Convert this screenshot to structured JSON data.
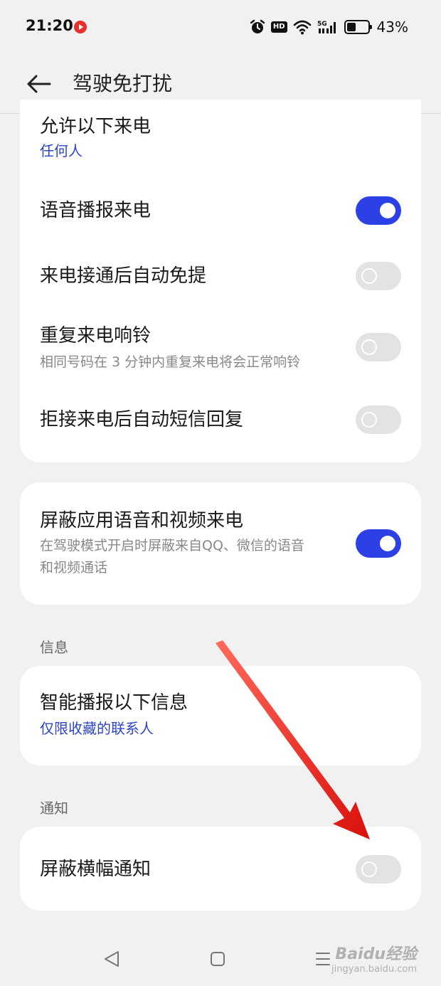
{
  "status_bar": {
    "time": "21:20",
    "indicators": [
      "alarm-icon",
      "hd-icon",
      "wifi-icon",
      "5g-signal-icon"
    ],
    "hd_label": "HD",
    "network_label": "5G",
    "battery_percent": "43%",
    "battery_level": 0.43
  },
  "header": {
    "title": "驾驶免打扰",
    "back_icon": "arrow-left-icon"
  },
  "calls_card": {
    "allow_calls": {
      "title": "允许以下来电",
      "value": "任何人"
    },
    "voice_announce": {
      "title": "语音播报来电",
      "enabled": true
    },
    "auto_handsfree": {
      "title": "来电接通后自动免提",
      "enabled": false
    },
    "repeat_ring": {
      "title": "重复来电响铃",
      "subtitle": "相同号码在 3 分钟内重复来电将会正常响铃",
      "enabled": false
    },
    "auto_sms": {
      "title": "拒接来电后自动短信回复",
      "enabled": false
    }
  },
  "block_app_calls": {
    "title": "屏蔽应用语音和视频来电",
    "subtitle_line1": "在驾驶模式开启时屏蔽来自QQ、微信的语音",
    "subtitle_line2": "和视频通话",
    "enabled": true
  },
  "messages_section": {
    "label": "信息",
    "smart_announce": {
      "title": "智能播报以下信息",
      "value": "仅限收藏的联系人"
    }
  },
  "notifications_section": {
    "label": "通知",
    "block_banner": {
      "title": "屏蔽横幅通知",
      "enabled": false
    }
  },
  "nav_bar": {
    "buttons": [
      "back-triangle-icon",
      "home-square-icon",
      "menu-lines-icon"
    ]
  },
  "watermark": {
    "main": "Baidu经验",
    "sub": "jingyan.baidu.com"
  },
  "colors": {
    "accent": "#2c40e6",
    "link": "#2c45c9",
    "background": "#f1f1f1",
    "card": "#ffffff",
    "annotation_arrow": "#e8201c"
  }
}
